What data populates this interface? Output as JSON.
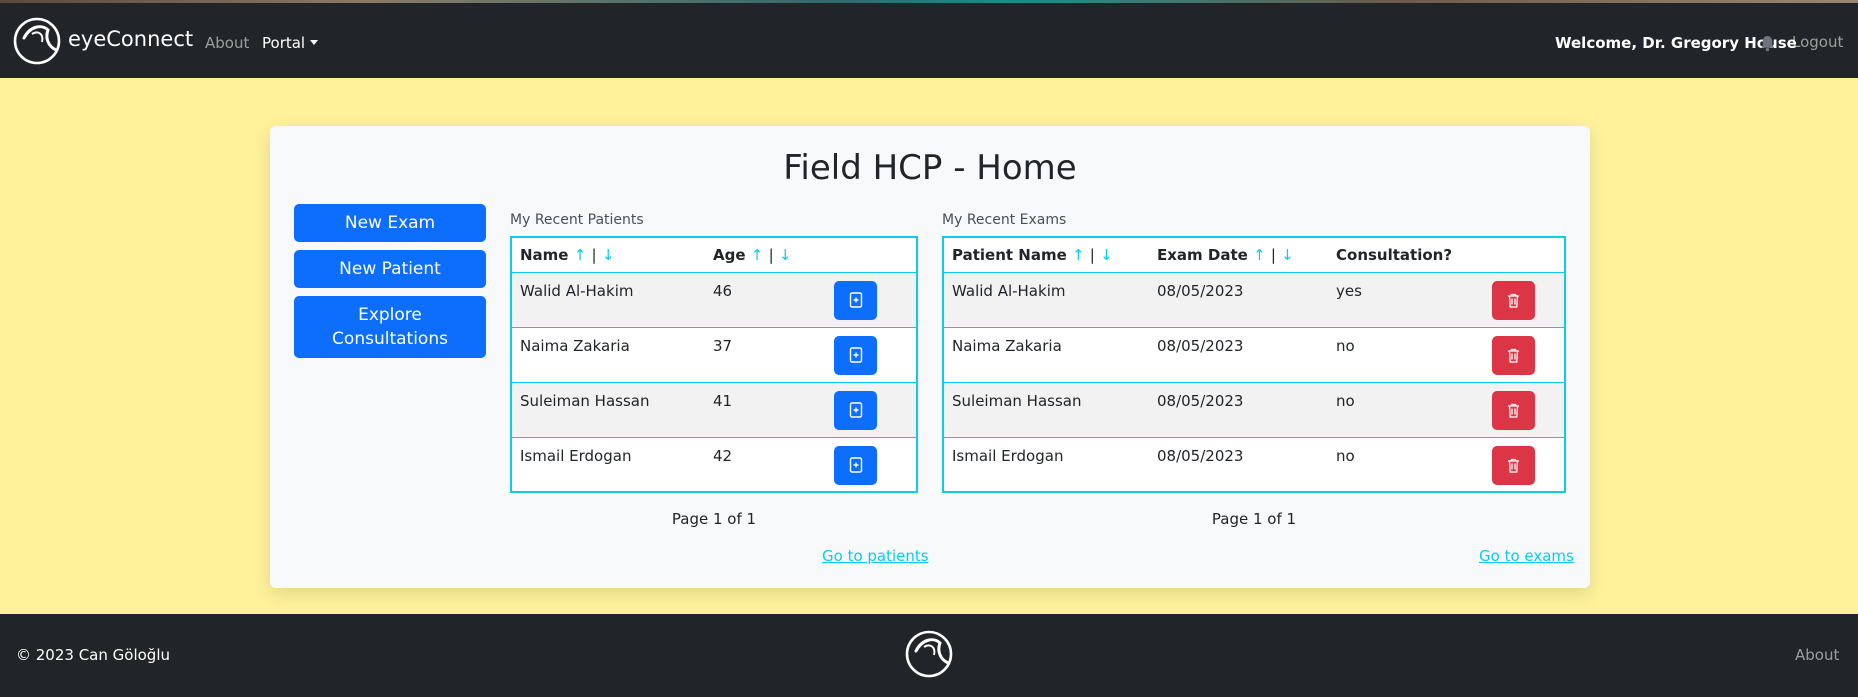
{
  "brand": {
    "name": "eyeConnect",
    "logo_icon": "eye-logo-icon"
  },
  "nav": {
    "about_label": "About",
    "portal_label": "Portal",
    "welcome_text": "Welcome, Dr. Gregory House",
    "bell_icon": "bell-icon",
    "logout_label": "Logout"
  },
  "page": {
    "title": "Field HCP - Home"
  },
  "actions": {
    "new_exam_label": "New Exam",
    "new_patient_label": "New Patient",
    "explore_consultations_line1": "Explore",
    "explore_consultations_line2": "Consultations"
  },
  "patients": {
    "section_label": "My Recent Patients",
    "columns": {
      "name": "Name",
      "age": "Age"
    },
    "sort_asc": "↑",
    "sort_sep": "|",
    "sort_desc": "↓",
    "rows": [
      {
        "name": "Walid Al-Hakim",
        "age": "46"
      },
      {
        "name": "Naima Zakaria",
        "age": "37"
      },
      {
        "name": "Suleiman Hassan",
        "age": "41"
      },
      {
        "name": "Ismail Erdogan",
        "age": "42"
      }
    ],
    "pager": "Page 1 of 1",
    "goto_label": "Go to patients"
  },
  "exams": {
    "section_label": "My Recent Exams",
    "columns": {
      "patient_name": "Patient Name",
      "exam_date": "Exam Date",
      "consultation": "Consultation?"
    },
    "sort_asc": "↑",
    "sort_sep": "|",
    "sort_desc": "↓",
    "rows": [
      {
        "patient_name": "Walid Al-Hakim",
        "exam_date": "08/05/2023",
        "consultation": "yes"
      },
      {
        "patient_name": "Naima Zakaria",
        "exam_date": "08/05/2023",
        "consultation": "no"
      },
      {
        "patient_name": "Suleiman Hassan",
        "exam_date": "08/05/2023",
        "consultation": "no"
      },
      {
        "patient_name": "Ismail Erdogan",
        "exam_date": "08/05/2023",
        "consultation": "no"
      }
    ],
    "pager": "Page 1 of 1",
    "goto_label": "Go to exams"
  },
  "footer": {
    "copyright": "© 2023 Can Göloğlu",
    "about_label": "About"
  },
  "colors": {
    "navbar": "#212529",
    "page_bg": "#fff29b",
    "primary": "#0d6efd",
    "danger": "#dc3545",
    "info": "#0dcaf0",
    "card": "#f8f9fa"
  }
}
